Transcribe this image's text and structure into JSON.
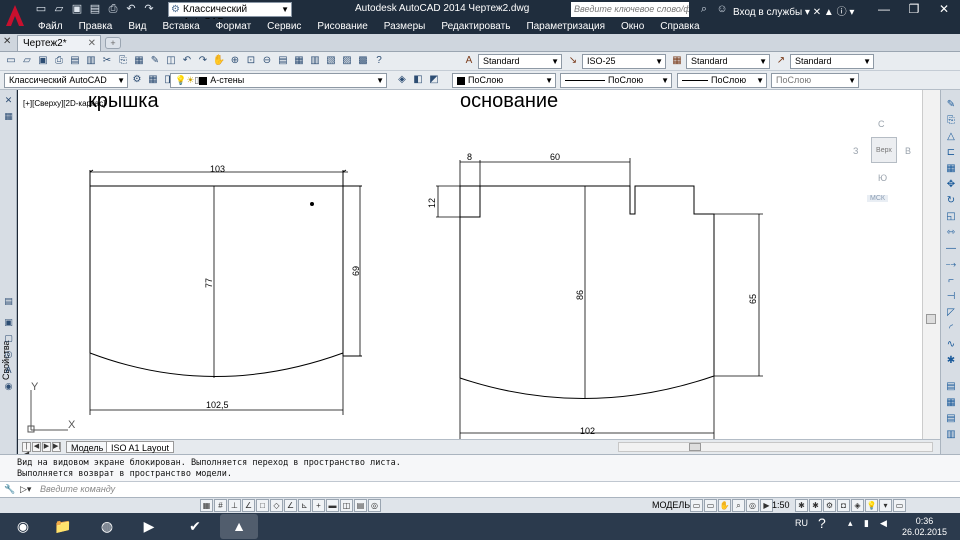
{
  "app": {
    "title": "Autodesk AutoCAD 2014    Чертеж2.dwg",
    "workspace": "Классический AutoCAD",
    "search_placeholder": "Введите ключевое слово/фразу",
    "sign_in": "Вход в службы"
  },
  "menu": [
    "Файл",
    "Правка",
    "Вид",
    "Вставка",
    "Формат",
    "Сервис",
    "Рисование",
    "Размеры",
    "Редактировать",
    "Параметризация",
    "Окно",
    "Справка"
  ],
  "doc_tab": {
    "label": "Чертеж2*"
  },
  "toolbar": {
    "text_style": "Standard",
    "dim_style": "ISO-25",
    "table_style": "Standard",
    "mleader_style": "Standard",
    "workspace2": "Классический AutoCAD",
    "layer": "А-стены",
    "color": "ПоСлою",
    "linetype": "ПоСлою",
    "lineweight": "ПоСлою",
    "plotstyle": "ПоСлою"
  },
  "sidebar_label": "Свойства",
  "viewport_label": "[+][Сверху][2D-каркас]",
  "viewcube": {
    "north": "С",
    "south": "Ю",
    "west": "З",
    "east": "В",
    "face": "Верх",
    "ucs": "МСК"
  },
  "drawing": {
    "left_title": "крышка",
    "right_title": "основание",
    "dims_left": {
      "top": "103",
      "height": "77",
      "side": "69",
      "bottom": "102,5"
    },
    "dims_right": {
      "a": "8",
      "b": "60",
      "c": "12",
      "height": "86",
      "side": "65",
      "bottom": "102"
    }
  },
  "layout_tabs": [
    "Модель",
    "ISO A1 Layout"
  ],
  "command_history": [
    "Вид на видовом экране блокирован. Выполняется переход в пространство листа.",
    "Выполняется возврат в пространство модели."
  ],
  "command_placeholder": "Введите команду",
  "status": {
    "model": "МОДЕЛЬ",
    "scale": "1:50"
  },
  "taskbar": {
    "lang": "RU",
    "time": "0:36",
    "date": "26.02.2015"
  }
}
